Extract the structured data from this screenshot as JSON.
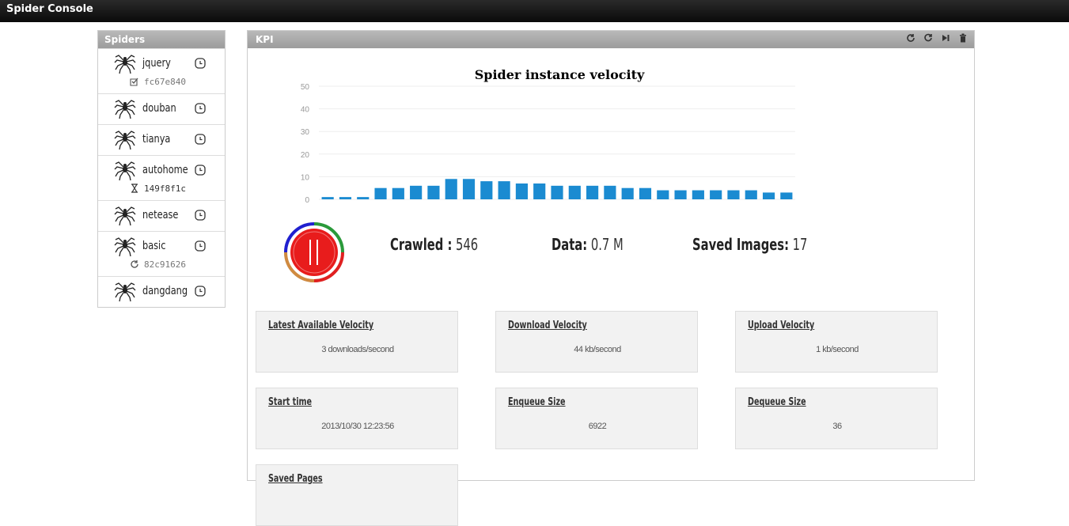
{
  "app": {
    "title": "Spider Console"
  },
  "sidebar": {
    "title": "Spiders",
    "items": [
      {
        "name": "jquery",
        "sub": "fc67e840",
        "sub_icon": "checkbox-icon",
        "sub_dark": false
      },
      {
        "name": "douban"
      },
      {
        "name": "tianya"
      },
      {
        "name": "autohome",
        "sub": "149f8f1c",
        "sub_icon": "hourglass-icon",
        "sub_dark": true
      },
      {
        "name": "netease"
      },
      {
        "name": "basic",
        "sub": "82c91626",
        "sub_icon": "refresh-icon",
        "sub_dark": false
      },
      {
        "name": "dangdang"
      }
    ]
  },
  "panel": {
    "title": "KPI",
    "tools": [
      "refresh-icon",
      "reload-icon",
      "step-icon",
      "trash-icon"
    ]
  },
  "chart_data": {
    "type": "bar",
    "title": "Spider instance velocity",
    "ylim": [
      0,
      50
    ],
    "yticks": [
      0,
      10,
      20,
      30,
      40,
      50
    ],
    "values": [
      1,
      1,
      1,
      5,
      5,
      6,
      6,
      9,
      9,
      8,
      8,
      7,
      7,
      6,
      6,
      6,
      6,
      5,
      5,
      4,
      4,
      4,
      4,
      4,
      4,
      3,
      3
    ],
    "color": "#1b8bd1",
    "grid": true
  },
  "stats": {
    "crawled_label": "Crawled :",
    "crawled_value": "546",
    "data_label": "Data:",
    "data_value": "0.7 M",
    "images_label": "Saved Images:",
    "images_value": "17"
  },
  "cards": [
    {
      "title": "Latest Available Velocity",
      "value": "3 downloads/second"
    },
    {
      "title": "Download Velocity",
      "value": "44 kb/second"
    },
    {
      "title": "Upload Velocity",
      "value": "1 kb/second"
    },
    {
      "title": "Start time",
      "value": "2013/10/30 12:23:56"
    },
    {
      "title": "Enqueue Size",
      "value": "6922"
    },
    {
      "title": "Dequeue Size",
      "value": "36"
    },
    {
      "title": "Saved Pages",
      "value": ""
    }
  ]
}
